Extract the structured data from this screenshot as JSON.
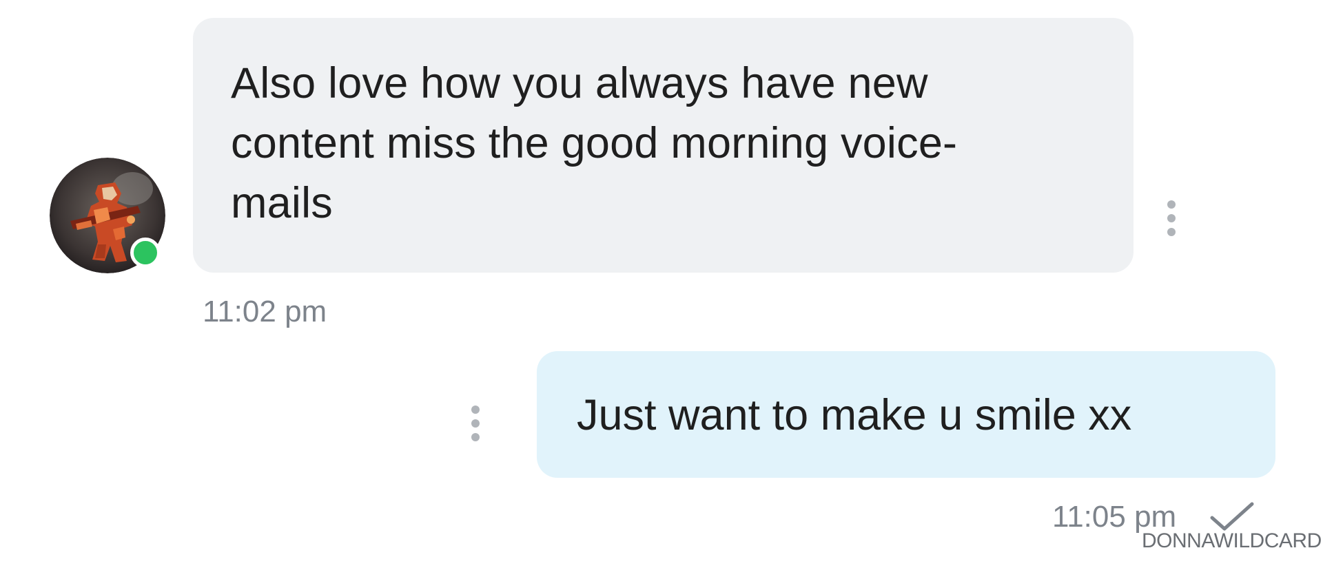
{
  "messages": [
    {
      "direction": "incoming",
      "text": "Also love how you always have new\ncontent miss the good morning voice-\nmails",
      "time": "11:02 pm",
      "sender_online": true,
      "avatar_icon": "avatar-armored-warrior-icon",
      "menu_icon": "more-vertical-icon"
    },
    {
      "direction": "outgoing",
      "text": "Just want to make u smile xx",
      "time": "11:05 pm",
      "status_icon": "sent-check-icon",
      "menu_icon": "more-vertical-icon"
    }
  ],
  "watermark": "DONNAWILDCARD",
  "colors": {
    "incoming_bubble": "#eff1f3",
    "outgoing_bubble": "#e1f3fb",
    "message_text": "#1f1f1f",
    "timestamp": "#7d838b",
    "online_indicator": "#2cc35f"
  }
}
